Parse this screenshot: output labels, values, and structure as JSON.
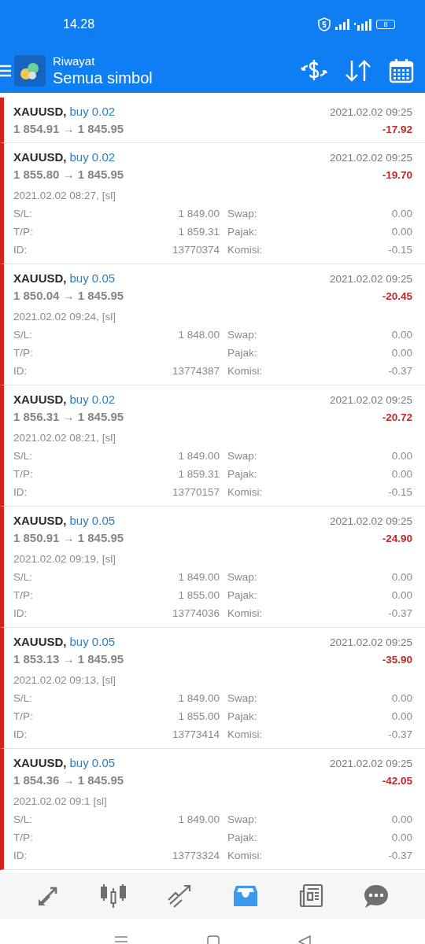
{
  "status_bar": {
    "time": "14.28",
    "battery": "8"
  },
  "app_bar": {
    "title": "Riwayat",
    "subtitle": "Semua simbol"
  },
  "deals": [
    {
      "symbol": "XAUUSD,",
      "side": "buy 0.02",
      "prices": "1 854.91 → 1 845.95",
      "close_time": "2021.02.02 09:25",
      "profit": "-17.92",
      "expanded": false
    },
    {
      "symbol": "XAUUSD,",
      "side": "buy 0.02",
      "prices": "1 855.80 → 1 845.95",
      "close_time": "2021.02.02 09:25",
      "profit": "-19.70",
      "expanded": true,
      "open_time": "2021.02.02 08:27,",
      "reason": "[sl]",
      "details": [
        {
          "label": "S/L:",
          "value": "1 849.00"
        },
        {
          "label": "Swap:",
          "value": "0.00"
        },
        {
          "label": "T/P:",
          "value": "1 859.31"
        },
        {
          "label": "Pajak:",
          "value": "0.00"
        },
        {
          "label": "ID:",
          "value": "13770374"
        },
        {
          "label": "Komisi:",
          "value": "-0.15"
        }
      ]
    },
    {
      "symbol": "XAUUSD,",
      "side": "buy 0.05",
      "prices": "1 850.04 → 1 845.95",
      "close_time": "2021.02.02 09:25",
      "profit": "-20.45",
      "expanded": true,
      "open_time": "2021.02.02 09:24,",
      "reason": "[sl]",
      "details": [
        {
          "label": "S/L:",
          "value": "1 848.00"
        },
        {
          "label": "Swap:",
          "value": "0.00"
        },
        {
          "label": "T/P:"
        },
        {
          "label": "Pajak:",
          "value": "0.00"
        },
        {
          "label": "ID:",
          "value": "13774387"
        },
        {
          "label": "Komisi:",
          "value": "-0.37"
        }
      ]
    },
    {
      "symbol": "XAUUSD,",
      "side": "buy 0.02",
      "prices": "1 856.31 → 1 845.95",
      "close_time": "2021.02.02 09:25",
      "profit": "-20.72",
      "expanded": true,
      "open_time": "2021.02.02 08:21,",
      "reason": "[sl]",
      "details": [
        {
          "label": "S/L:",
          "value": "1 849.00"
        },
        {
          "label": "Swap:",
          "value": "0.00"
        },
        {
          "label": "T/P:",
          "value": "1 859.31"
        },
        {
          "label": "Pajak:",
          "value": "0.00"
        },
        {
          "label": "ID:",
          "value": "13770157"
        },
        {
          "label": "Komisi:",
          "value": "-0.15"
        }
      ]
    },
    {
      "symbol": "XAUUSD,",
      "side": "buy 0.05",
      "prices": "1 850.91 → 1 845.95",
      "close_time": "2021.02.02 09:25",
      "profit": "-24.90",
      "expanded": true,
      "open_time": "2021.02.02 09:19,",
      "reason": "[sl]",
      "details": [
        {
          "label": "S/L:",
          "value": "1 849.00"
        },
        {
          "label": "Swap:",
          "value": "0.00"
        },
        {
          "label": "T/P:",
          "value": "1 855.00"
        },
        {
          "label": "Pajak:",
          "value": "0.00"
        },
        {
          "label": "ID:",
          "value": "13774036"
        },
        {
          "label": "Komisi:",
          "value": "-0.37"
        }
      ]
    },
    {
      "symbol": "XAUUSD,",
      "side": "buy 0.05",
      "prices": "1 853.13 → 1 845.95",
      "close_time": "2021.02.02 09:25",
      "profit": "-35.90",
      "expanded": true,
      "open_time": "2021.02.02 09:13,",
      "reason": "[sl]",
      "details": [
        {
          "label": "S/L:",
          "value": "1 849.00"
        },
        {
          "label": "Swap:",
          "value": "0.00"
        },
        {
          "label": "T/P:",
          "value": "1 855.00"
        },
        {
          "label": "Pajak:",
          "value": "0.00"
        },
        {
          "label": "ID:",
          "value": "13773414"
        },
        {
          "label": "Komisi:",
          "value": "-0.37"
        }
      ]
    },
    {
      "symbol": "XAUUSD,",
      "side": "buy 0.05",
      "prices": "1 854.36 → 1 845.95",
      "close_time": "2021.02.02 09:25",
      "profit": "-42.05",
      "expanded": true,
      "open_time": "2021.02.02 09:1",
      "reason": "[sl]",
      "details": [
        {
          "label": "S/L:",
          "value": "1 849.00"
        },
        {
          "label": "Swap:",
          "value": "0.00"
        },
        {
          "label": "T/P:"
        },
        {
          "label": "Pajak:",
          "value": "0.00"
        },
        {
          "label": "ID:",
          "value": "13773324"
        },
        {
          "label": "Komisi:",
          "value": "-0.37"
        }
      ]
    }
  ],
  "bottom_nav": [
    {
      "kind": "trade",
      "selected": false
    },
    {
      "kind": "chart",
      "selected": false
    },
    {
      "kind": "trend",
      "selected": false
    },
    {
      "kind": "history",
      "selected": true
    },
    {
      "kind": "news",
      "selected": false
    },
    {
      "kind": "chat",
      "selected": false
    }
  ]
}
